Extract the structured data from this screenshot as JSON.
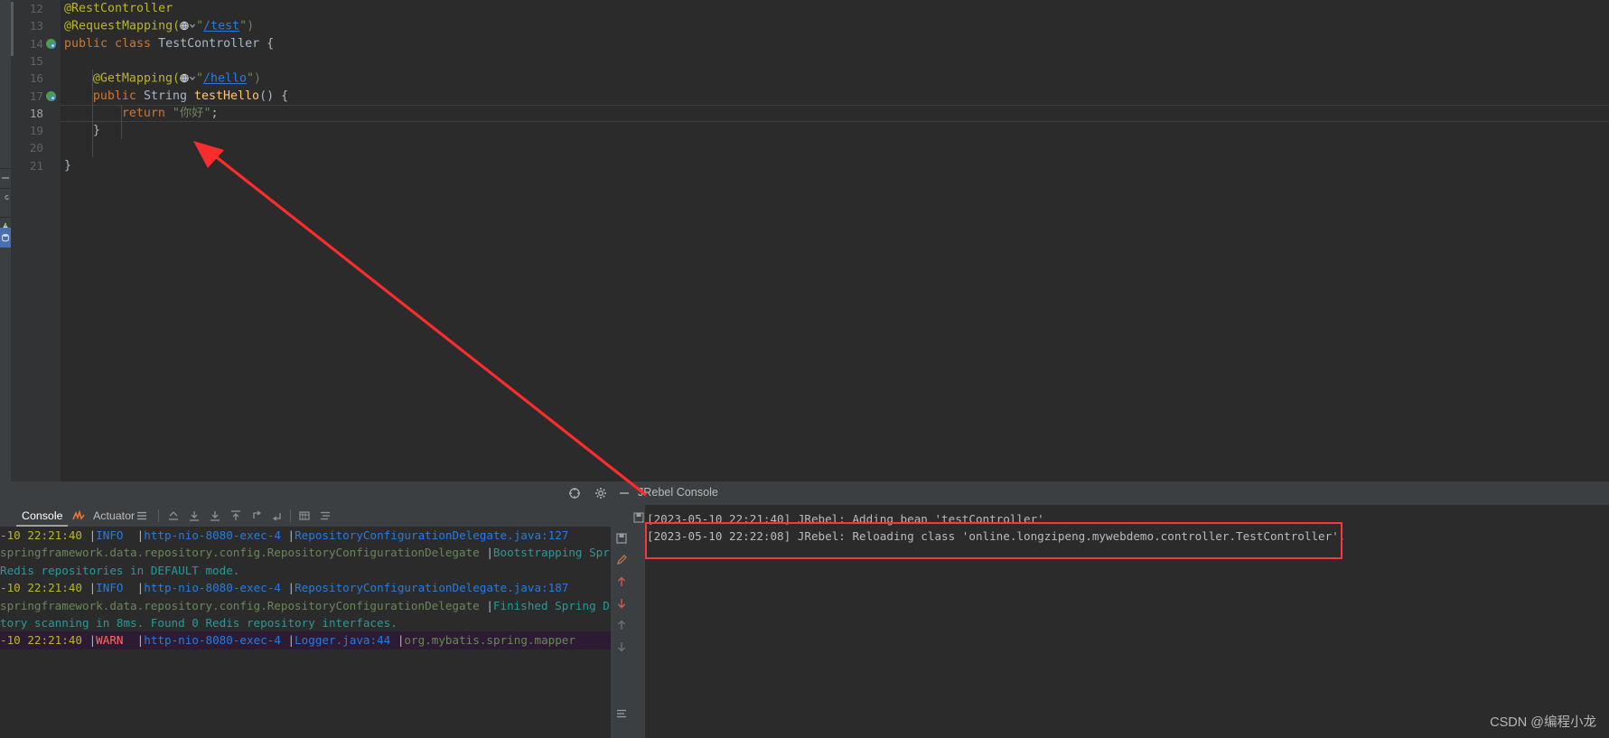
{
  "editor": {
    "lines": [
      {
        "num": "12",
        "indent": 0,
        "fold": "minus",
        "gutter_icon": null,
        "tokens": [
          {
            "t": "@RestController",
            "c": "an"
          }
        ]
      },
      {
        "num": "13",
        "indent": 0,
        "fold": "minus",
        "gutter_icon": null,
        "tokens": [
          {
            "t": "@RequestMapping(",
            "c": "an"
          },
          {
            "t": "GLOBE",
            "c": "icon"
          },
          {
            "t": "\"",
            "c": "s"
          },
          {
            "t": "/test",
            "c": "url"
          },
          {
            "t": "\")",
            "c": "s"
          }
        ]
      },
      {
        "num": "14",
        "indent": 0,
        "fold": null,
        "gutter_icon": "bean-icon",
        "tokens": [
          {
            "t": "public class ",
            "c": "k"
          },
          {
            "t": "TestController",
            "c": "ty"
          },
          {
            "t": " {",
            "c": "p"
          }
        ]
      },
      {
        "num": "15",
        "indent": 0,
        "fold": null,
        "gutter_icon": null,
        "tokens": []
      },
      {
        "num": "16",
        "indent": 1,
        "fold": null,
        "gutter_icon": null,
        "tokens": [
          {
            "t": "@GetMapping(",
            "c": "an"
          },
          {
            "t": "GLOBE",
            "c": "icon"
          },
          {
            "t": "\"",
            "c": "s"
          },
          {
            "t": "/hello",
            "c": "url"
          },
          {
            "t": "\")",
            "c": "s"
          }
        ]
      },
      {
        "num": "17",
        "indent": 1,
        "fold": "minus",
        "gutter_icon": "bean-icon",
        "tokens": [
          {
            "t": "public ",
            "c": "k"
          },
          {
            "t": "String ",
            "c": "ty"
          },
          {
            "t": "testHello",
            "c": "fn"
          },
          {
            "t": "() {",
            "c": "p"
          }
        ]
      },
      {
        "num": "18",
        "indent": 2,
        "fold": null,
        "gutter_icon": null,
        "current": true,
        "tokens": [
          {
            "t": "return ",
            "c": "k"
          },
          {
            "t": "\"你好\"",
            "c": "s"
          },
          {
            "t": ";",
            "c": "p"
          }
        ]
      },
      {
        "num": "19",
        "indent": 1,
        "fold": "end",
        "gutter_icon": null,
        "tokens": [
          {
            "t": "}",
            "c": "p"
          }
        ]
      },
      {
        "num": "20",
        "indent": 0,
        "fold": null,
        "gutter_icon": null,
        "tokens": []
      },
      {
        "num": "21",
        "indent": 0,
        "fold": null,
        "gutter_icon": null,
        "tokens": [
          {
            "t": "}",
            "c": "p"
          }
        ]
      }
    ]
  },
  "left_strip": {
    "items": [
      {
        "name": "structure-icon",
        "icon": "branch"
      },
      {
        "name": "build-icon",
        "icon": "wrench"
      },
      {
        "name": "maven-icon",
        "icon": "maven"
      },
      {
        "name": "database-icon",
        "icon": "database",
        "selected": true
      }
    ]
  },
  "run_panel": {
    "header_icons": [
      {
        "name": "settings-gear-icon",
        "glyph": "gear"
      },
      {
        "name": "hide-icon",
        "glyph": "minus"
      }
    ],
    "tabs": [
      {
        "label": "Console",
        "active": true
      },
      {
        "label": "Actuator",
        "active": false,
        "icon": "actuator-icon"
      }
    ],
    "toolbar_icons": [
      "list-icon",
      "soft-wrap-icon",
      "scroll-down-icon",
      "scroll-bottom-icon",
      "scroll-up-icon",
      "up-stack-icon",
      "down-stack-icon",
      "print-icon",
      "settings-list-icon"
    ],
    "side_toolbar_icons": [
      "save-icon",
      "edit-icon",
      "prev-occurrence-icon",
      "next-occurrence-icon",
      "soft-wrap-arrow-icon",
      "scroll-end-icon",
      "wrap-text-icon"
    ],
    "console_lines": [
      {
        "segments": [
          {
            "t": "-10 22:21:40 ",
            "c": "c-time"
          },
          {
            "t": "|",
            "c": "c-pipe"
          },
          {
            "t": "INFO  ",
            "c": "c-info"
          },
          {
            "t": "|",
            "c": "c-pipe"
          },
          {
            "t": "http-nio-8080-exec-4 ",
            "c": "c-thread"
          },
          {
            "t": "|",
            "c": "c-pipe"
          },
          {
            "t": "RepositoryConfigurationDelegate.java:127",
            "c": "c-src"
          }
        ]
      },
      {
        "segments": [
          {
            "t": "springframework.data.repository.config.RepositoryConfigurationDelegate ",
            "c": "c-logger"
          },
          {
            "t": "|",
            "c": "c-pipe"
          },
          {
            "t": "Bootstrapping Spring",
            "c": "c-msg"
          }
        ]
      },
      {
        "segments": [
          {
            "t": "Redis repositories in DEFAULT mode.",
            "c": "c-msg"
          }
        ]
      },
      {
        "segments": [
          {
            "t": "-10 22:21:40 ",
            "c": "c-time"
          },
          {
            "t": "|",
            "c": "c-pipe"
          },
          {
            "t": "INFO  ",
            "c": "c-info"
          },
          {
            "t": "|",
            "c": "c-pipe"
          },
          {
            "t": "http-nio-8080-exec-4 ",
            "c": "c-thread"
          },
          {
            "t": "|",
            "c": "c-pipe"
          },
          {
            "t": "RepositoryConfigurationDelegate.java:187",
            "c": "c-src"
          }
        ]
      },
      {
        "segments": [
          {
            "t": "springframework.data.repository.config.RepositoryConfigurationDelegate ",
            "c": "c-logger"
          },
          {
            "t": "|",
            "c": "c-pipe"
          },
          {
            "t": "Finished Spring Data",
            "c": "c-msg"
          }
        ]
      },
      {
        "segments": [
          {
            "t": "tory scanning in 8ms. Found 0 Redis repository interfaces.",
            "c": "c-msg"
          }
        ]
      },
      {
        "warn": true,
        "segments": [
          {
            "t": "-10 22:21:40 ",
            "c": "c-time"
          },
          {
            "t": "|",
            "c": "c-pipe"
          },
          {
            "t": "WARN  ",
            "c": "c-warn"
          },
          {
            "t": "|",
            "c": "c-pipe"
          },
          {
            "t": "http-nio-8080-exec-4 ",
            "c": "c-thread"
          },
          {
            "t": "|",
            "c": "c-pipe"
          },
          {
            "t": "Logger.java:44 ",
            "c": "c-src"
          },
          {
            "t": "|",
            "c": "c-pipe"
          },
          {
            "t": "org.mybatis.spring.mapper",
            "c": "c-logger"
          }
        ]
      }
    ]
  },
  "jrebel": {
    "title": "JRebel Console",
    "header_icons": [
      {
        "name": "locate-icon",
        "glyph": "crosshair"
      },
      {
        "name": "settings-gear-icon",
        "glyph": "gear"
      },
      {
        "name": "hide-icon",
        "glyph": "minus"
      }
    ],
    "side_toolbar_icons": [
      "save-icon",
      "edit-icon",
      "prev-occurrence-icon",
      "next-occurrence-icon",
      "prev-item-icon",
      "next-item-icon",
      "wrap-text-icon"
    ],
    "lines": [
      "[2023-05-10 22:21:40] JRebel: Adding bean 'testController'",
      "[2023-05-10 22:22:08] JRebel: Reloading class 'online.longzipeng.mywebdemo.controller.TestController'."
    ]
  },
  "annotations": {
    "arrow_color": "#fb2c2c",
    "highlight_color": "#f5383b"
  },
  "watermark": {
    "text": "CSDN @编程小龙"
  }
}
